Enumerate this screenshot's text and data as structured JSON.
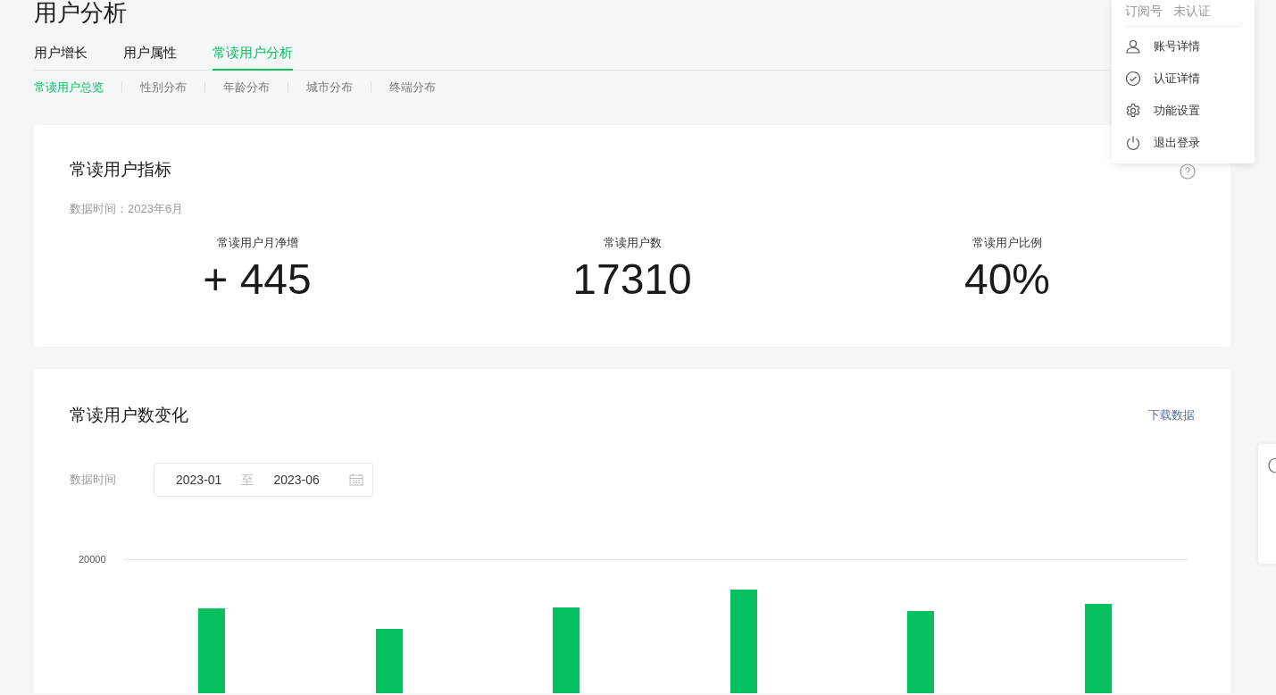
{
  "page_title": "用户分析",
  "tabs": [
    {
      "label": "用户增长",
      "selected": false
    },
    {
      "label": "用户属性",
      "selected": false
    },
    {
      "label": "常读用户分析",
      "selected": true
    }
  ],
  "subtabs": [
    {
      "label": "常读用户总览",
      "selected": true
    },
    {
      "label": "性别分布",
      "selected": false
    },
    {
      "label": "年龄分布",
      "selected": false
    },
    {
      "label": "城市分布",
      "selected": false
    },
    {
      "label": "终端分布",
      "selected": false
    }
  ],
  "metrics_card": {
    "title": "常读用户指标",
    "data_time": "数据时间：2023年6月",
    "metrics": [
      {
        "label": "常读用户月净增",
        "value": "+ 445"
      },
      {
        "label": "常读用户数",
        "value": "17310"
      },
      {
        "label": "常读用户比例",
        "value": "40%"
      }
    ]
  },
  "trend_card": {
    "title": "常读用户数变化",
    "download": "下载数据",
    "date_label": "数据时间",
    "date_from": "2023-01",
    "date_separator": "至",
    "date_to": "2023-06",
    "gridline_label": "20000"
  },
  "account_menu": {
    "account_type": "订阅号",
    "verification": "未认证",
    "items": [
      {
        "kind": "user",
        "label": "账号详情"
      },
      {
        "kind": "check",
        "label": "认证详情"
      },
      {
        "kind": "gear",
        "label": "功能设置"
      },
      {
        "kind": "power",
        "label": "退出登录"
      }
    ]
  }
}
